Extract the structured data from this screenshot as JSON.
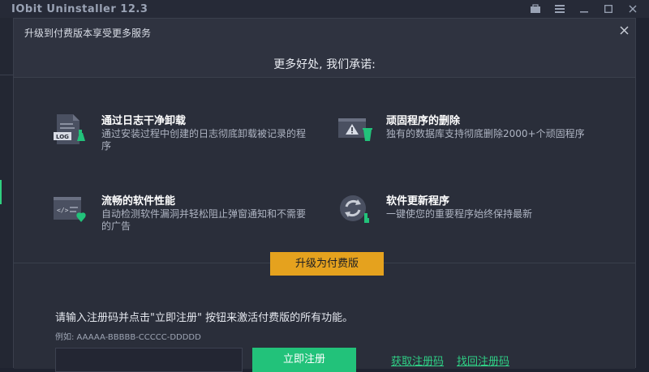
{
  "app": {
    "title": "IObit Uninstaller 12.3"
  },
  "dialog": {
    "title": "升级到付费版本享受更多服务",
    "heading": "更多好处, 我们承诺:"
  },
  "features": [
    {
      "title": "通过日志干净卸载",
      "desc": "通过安装过程中创建的日志彻底卸载被记录的程序",
      "icon": "log-file-icon",
      "icon_label": "LOG"
    },
    {
      "title": "顽固程序的删除",
      "desc": "独有的数据库支持彻底删除2000+个顽固程序",
      "icon": "warning-window-icon"
    },
    {
      "title": "流畅的软件性能",
      "desc": "自动检测软件漏洞并轻松阻止弹窗通知和不需要的广告",
      "icon": "code-window-shield-icon"
    },
    {
      "title": "软件更新程序",
      "desc": "一键使您的重要程序始终保持最新",
      "icon": "update-refresh-icon"
    }
  ],
  "upgrade": {
    "label": "升级为付费版"
  },
  "registration": {
    "prompt": "请输入注册码并点击\"立即注册\" 按钮来激活付费版的所有功能。",
    "example": "例如: AAAAA-BBBBB-CCCCC-DDDDD",
    "input_value": "",
    "activate_label": "立即注册",
    "get_code_label": "获取注册码",
    "recover_code_label": "找回注册码"
  },
  "colors": {
    "accent_orange": "#e5a21e",
    "accent_green": "#22c27a",
    "link_green": "#2fcf85",
    "bg": "#2a2e3a"
  }
}
